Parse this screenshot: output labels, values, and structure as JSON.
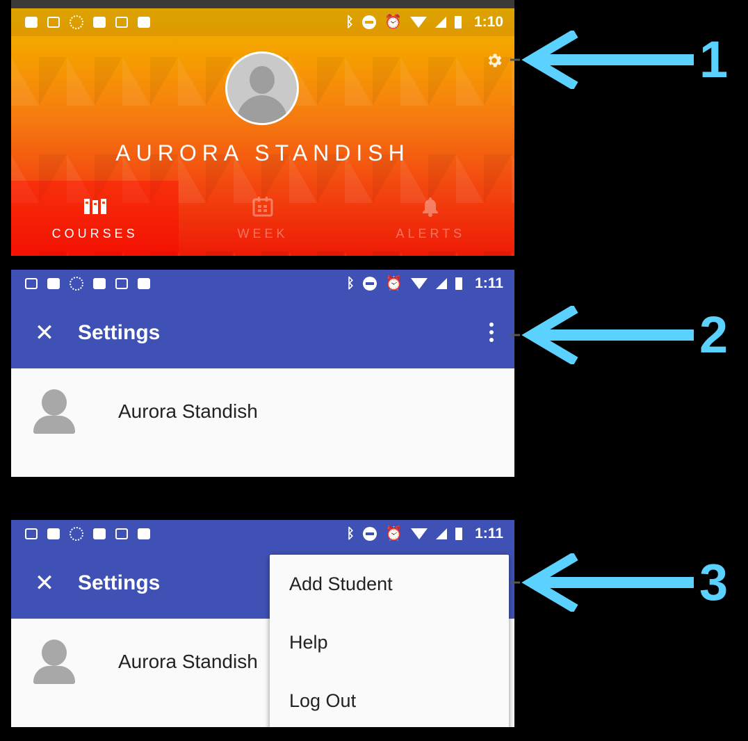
{
  "status_bar_1": {
    "time": "1:10"
  },
  "status_bar_2": {
    "time": "1:11"
  },
  "status_bar_3": {
    "time": "1:11"
  },
  "profile": {
    "name": "AURORA STANDISH",
    "tabs": [
      {
        "label": "COURSES",
        "icon": "courses-icon",
        "active": true
      },
      {
        "label": "WEEK",
        "icon": "calendar-icon",
        "active": false
      },
      {
        "label": "ALERTS",
        "icon": "bell-icon",
        "active": false
      }
    ]
  },
  "settings": {
    "title": "Settings",
    "user_name": "Aurora Standish"
  },
  "overflow_menu": {
    "items": [
      "Add Student",
      "Help",
      "Log Out"
    ]
  },
  "callouts": [
    "1",
    "2",
    "3"
  ],
  "colors": {
    "appbar": "#3f51b5",
    "arrow": "#5ad1ff",
    "header_top": "#f0b400",
    "header_bottom": "#ee1a06"
  }
}
